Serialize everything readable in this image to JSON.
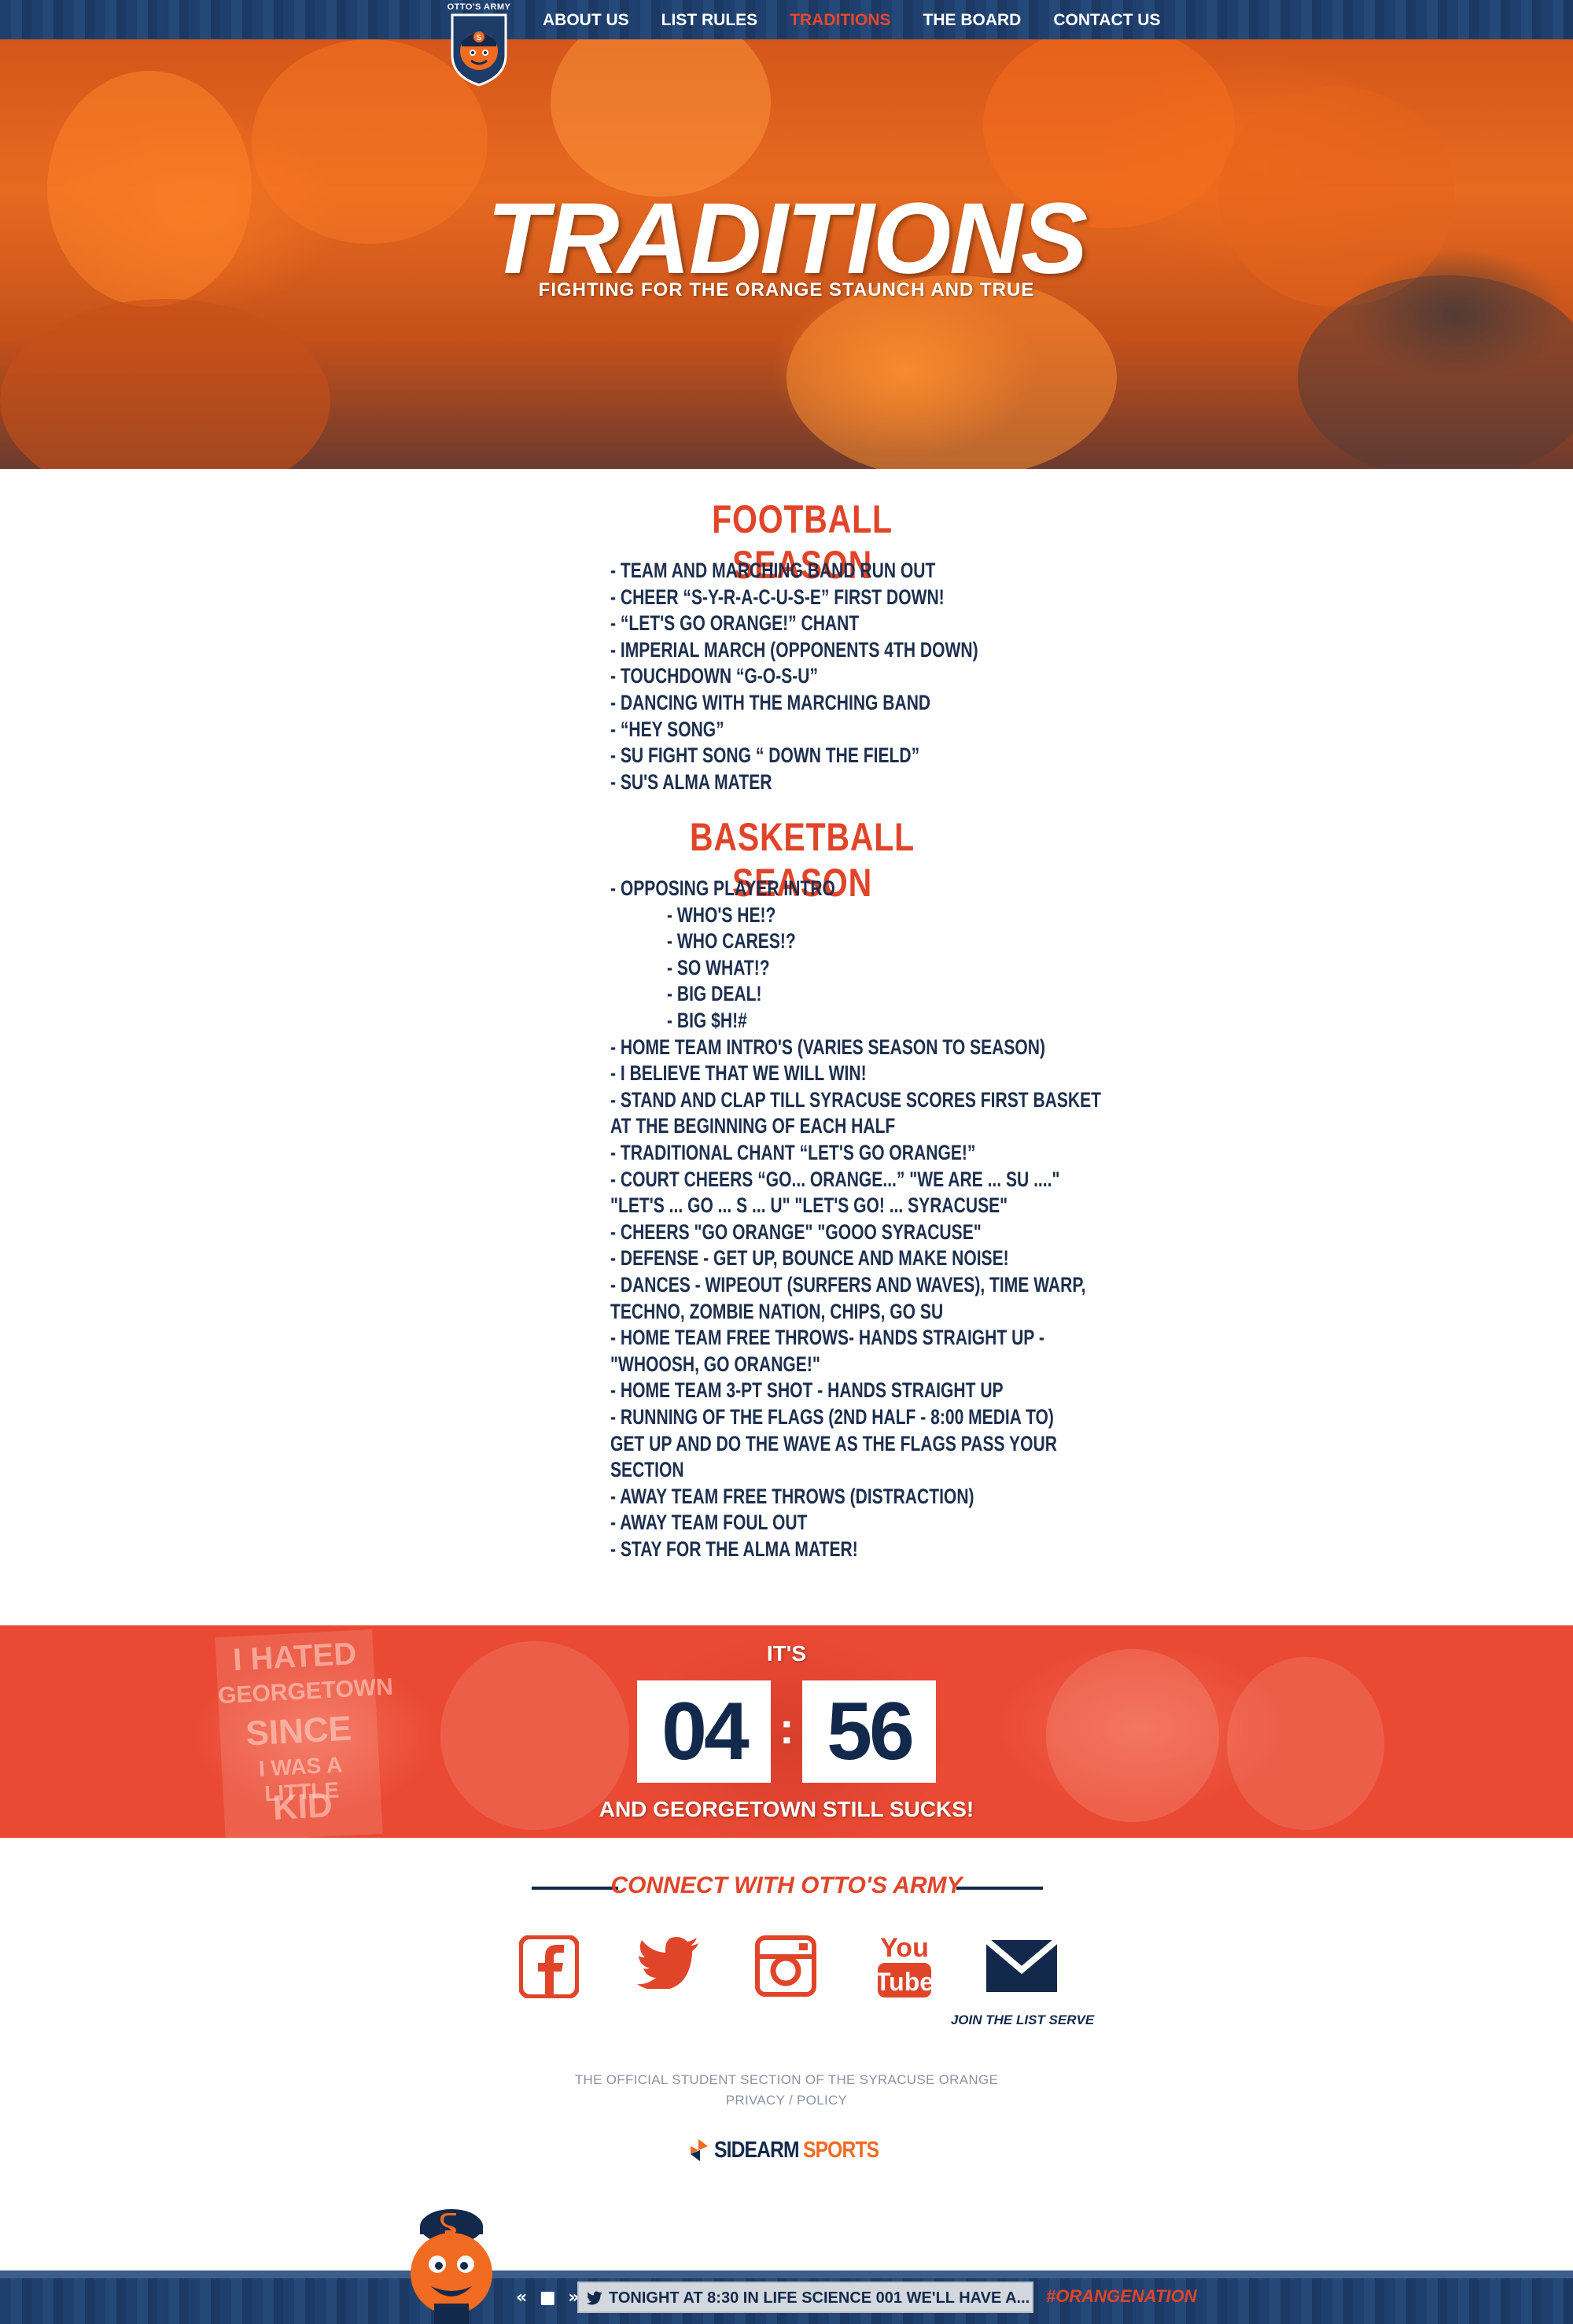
{
  "nav": {
    "logo_text": "OTTO'S ARMY",
    "items": [
      {
        "label": "ABOUT US",
        "active": false
      },
      {
        "label": "LIST RULES",
        "active": false
      },
      {
        "label": "TRADITIONS",
        "active": true
      },
      {
        "label": "THE BOARD",
        "active": false
      },
      {
        "label": "CONTACT US",
        "active": false
      }
    ]
  },
  "hero": {
    "title": "TRADITIONS",
    "subtitle": "FIGHTING FOR THE ORANGE STAUNCH AND TRUE"
  },
  "football": {
    "heading": "FOOTBALL SEASON",
    "items": [
      "- TEAM AND MARCHING BAND RUN OUT",
      "- CHEER “S-Y-R-A-C-U-S-E” FIRST DOWN!",
      "- “LET'S GO ORANGE!” CHANT",
      "- IMPERIAL MARCH (OPPONENTS 4TH DOWN)",
      "- TOUCHDOWN “G-O-S-U”",
      "- DANCING WITH THE MARCHING BAND",
      "- “HEY SONG”",
      "- SU FIGHT SONG “ DOWN THE FIELD”",
      "- SU'S ALMA MATER"
    ]
  },
  "basketball": {
    "heading": "BASKETBALL SEASON",
    "items": [
      "- OPPOSING PLAYER INTRO",
      "- WHO'S HE!?",
      "- WHO CARES!?",
      "- SO WHAT!?",
      "- BIG DEAL!",
      "- BIG $H!#",
      "- HOME TEAM INTRO'S (VARIES SEASON TO SEASON)",
      "- I BELIEVE THAT WE WILL WIN!",
      "- STAND AND CLAP TILL SYRACUSE SCORES FIRST BASKET",
      "AT THE BEGINNING OF EACH HALF",
      "- TRADITIONAL CHANT “LET'S GO ORANGE!”",
      "- COURT CHEERS “GO... ORANGE...” \"WE ARE ... SU ....\"",
      "\"LET'S ... GO ... S ... U\" \"LET'S GO! ... SYRACUSE\"",
      "- CHEERS \"GO ORANGE\" \"GOOO SYRACUSE\"",
      "- DEFENSE - GET UP, BOUNCE AND MAKE NOISE!",
      "- DANCES - WIPEOUT (SURFERS AND WAVES), TIME WARP,",
      "TECHNO, ZOMBIE NATION, CHIPS, GO SU",
      "- HOME TEAM FREE THROWS- HANDS STRAIGHT UP -",
      "\"WHOOSH, GO ORANGE!\"",
      "- HOME TEAM 3-PT SHOT - HANDS STRAIGHT UP",
      "- RUNNING OF THE FLAGS (2ND HALF - 8:00 MEDIA TO)",
      "GET UP AND DO THE WAVE AS THE FLAGS PASS YOUR",
      "SECTION",
      "- AWAY TEAM FREE THROWS (DISTRACTION)",
      "- AWAY TEAM FOUL OUT",
      "- STAY FOR THE ALMA MATER!"
    ]
  },
  "countdown": {
    "prefix": "IT'S",
    "hours": "04",
    "separator": ":",
    "minutes": "56",
    "suffix": "AND GEORGETOWN STILL SUCKS!",
    "sign_lines": [
      "I HATED",
      "GEORGETOWN",
      "SINCE",
      "I WAS A LITTLE",
      "KID"
    ]
  },
  "connect": {
    "title": "CONNECT WITH OTTO'S ARMY",
    "join_label": "JOIN THE LIST SERVE",
    "youtube_top": "You",
    "youtube_bottom": "Tube"
  },
  "footer": {
    "official": "THE OFFICIAL STUDENT SECTION OF THE SYRACUSE ORANGE",
    "privacy": "PRIVACY / POLICY",
    "brand_left": "SIDEARM",
    "brand_right": "SPORTS"
  },
  "ticker": {
    "controls": "« ■ »",
    "message": "TONIGHT AT 8:30 IN LIFE SCIENCE 001 WE'LL HAVE A...",
    "hashtag": "#ORANGENATION"
  },
  "colors": {
    "navy": "#13294b",
    "orange_red": "#e0452a",
    "banner_red": "#ea4a34",
    "active_nav": "#e8482c"
  }
}
